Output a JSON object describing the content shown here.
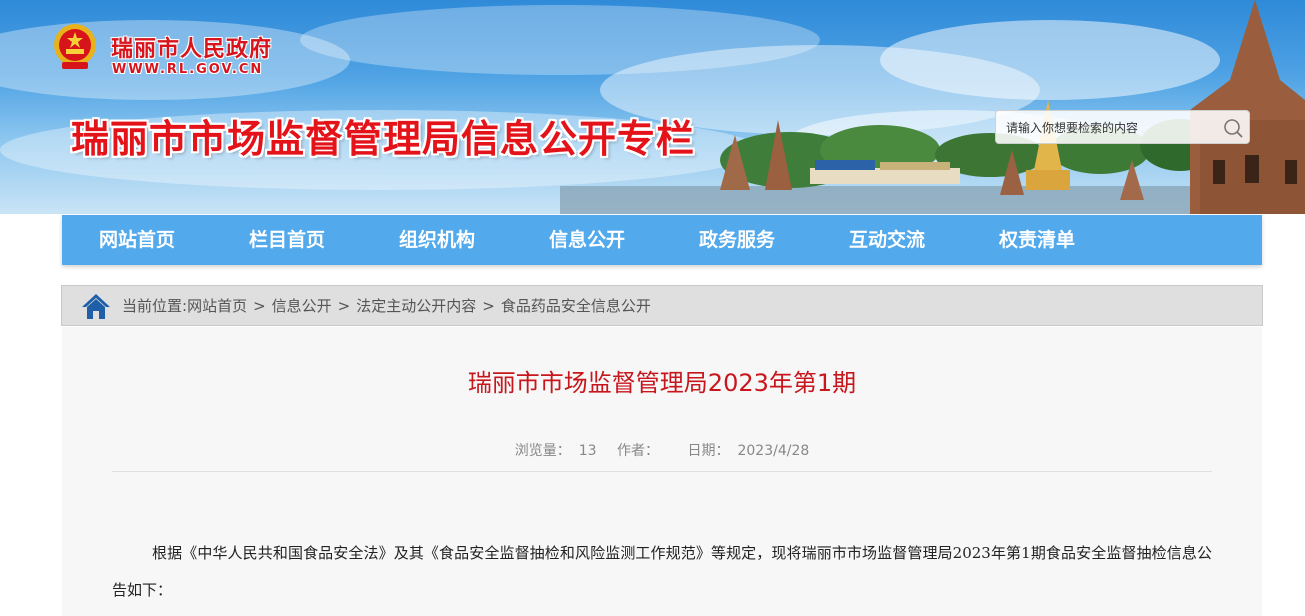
{
  "header": {
    "site_name": "瑞丽市人民政府",
    "site_url": "WWW.RL.GOV.CN",
    "column_title": "瑞丽市市场监督管理局信息公开专栏",
    "search_placeholder": "请输入你想要检索的内容"
  },
  "nav": {
    "items": [
      "网站首页",
      "栏目首页",
      "组织机构",
      "信息公开",
      "政务服务",
      "互动交流",
      "权责清单"
    ]
  },
  "breadcrumb": {
    "prefix": "当前位置:",
    "items": [
      "网站首页",
      "信息公开",
      "法定主动公开内容",
      "食品药品安全信息公开"
    ],
    "separator": ">"
  },
  "article": {
    "title": "瑞丽市市场监督管理局2023年第1期",
    "views_label": "浏览量：",
    "views": "13",
    "author_label": "作者：",
    "author": "",
    "date_label": "日期：",
    "date": "2023/4/28",
    "body": "根据《中华人民共和国食品安全法》及其《食品安全监督抽检和风险监测工作规范》等规定，现将瑞丽市市场监督管理局2023年第1期食品安全监督抽检信息公告如下："
  },
  "colors": {
    "nav_bg": "#52a9ec",
    "title_red": "#c8161d",
    "brand_red": "#e4131a"
  }
}
